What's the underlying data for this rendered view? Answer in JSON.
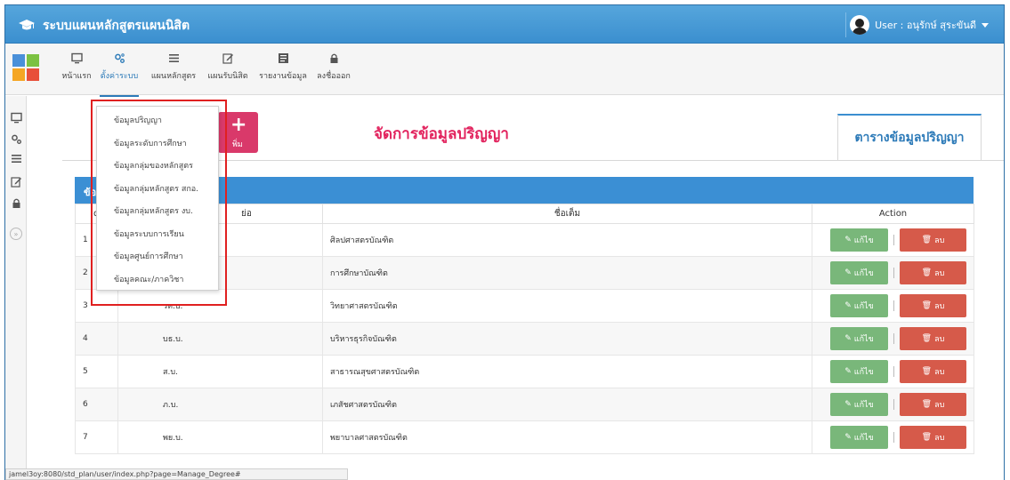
{
  "app": {
    "title": "ระบบแผนหลักสูตรแผนนิสิต",
    "user_label": "User : อนุรักษ์ สุระขันดี"
  },
  "toolbar": {
    "items": [
      {
        "label": "หน้าแรก",
        "icon": "monitor-icon"
      },
      {
        "label": "ตั้งค่าระบบ",
        "icon": "gears-icon"
      },
      {
        "label": "แผนหลักสูตร",
        "icon": "list-icon"
      },
      {
        "label": "แผนรับนิสิต",
        "icon": "edit-icon"
      },
      {
        "label": "รายงานข้อมูล",
        "icon": "report-icon"
      },
      {
        "label": "ลงชื่อออก",
        "icon": "lock-icon"
      }
    ],
    "apps_colors": [
      "#4a90d9",
      "#7cc242",
      "#f5a623",
      "#e8503a"
    ]
  },
  "dropdown": {
    "items": [
      "ข้อมูลปริญญา",
      "ข้อมูลระดับการศึกษา",
      "ข้อมูลกลุ่มของหลักสูตร",
      "ข้อมูลกลุ่มหลักสูตร สกอ.",
      "ข้อมูลกลุ่มหลักสูตร งบ.",
      "ข้อมูลระบบการเรียน",
      "ข้อมูลศูนย์การศึกษา",
      "ข้อมูลคณะ/ภาควิชา"
    ]
  },
  "main": {
    "add_button_label": "พิ่ม",
    "page_title": "จัดการข้อมูลปริญญา",
    "table_tab": "ตารางข้อมูลปริญญา",
    "panel_title": "ข้อม",
    "columns": {
      "id": "d",
      "abbr": "ย่อ",
      "full": "ชื่อเต็ม",
      "action": "Action"
    },
    "edit_label": "แก้ไข",
    "delete_label": "ลบ",
    "rows": [
      {
        "no": "1",
        "abbr": "",
        "full": "ศิลปศาสตรบัณฑิต"
      },
      {
        "no": "2",
        "abbr": "",
        "full": "การศึกษาบัณฑิต"
      },
      {
        "no": "3",
        "abbr": "วท.บ.",
        "full": "วิทยาศาสตรบัณฑิต"
      },
      {
        "no": "4",
        "abbr": "บธ.บ.",
        "full": "บริหารธุรกิจบัณฑิต"
      },
      {
        "no": "5",
        "abbr": "ส.บ.",
        "full": "สาธารณสุขศาสตรบัณฑิต"
      },
      {
        "no": "6",
        "abbr": "ภ.บ.",
        "full": "เภสัชศาสตรบัณฑิต"
      },
      {
        "no": "7",
        "abbr": "พย.บ.",
        "full": "พยาบาลศาสตรบัณฑิต"
      }
    ]
  },
  "statusbar": {
    "url": "jamel3oy:8080/std_plan/user/index.php?page=Manage_Degree#"
  },
  "colors": {
    "accent": "#3b8fd4",
    "title": "#e2235e",
    "edit": "#79b77a",
    "delete": "#d65a4a",
    "add": "#d9396a"
  }
}
